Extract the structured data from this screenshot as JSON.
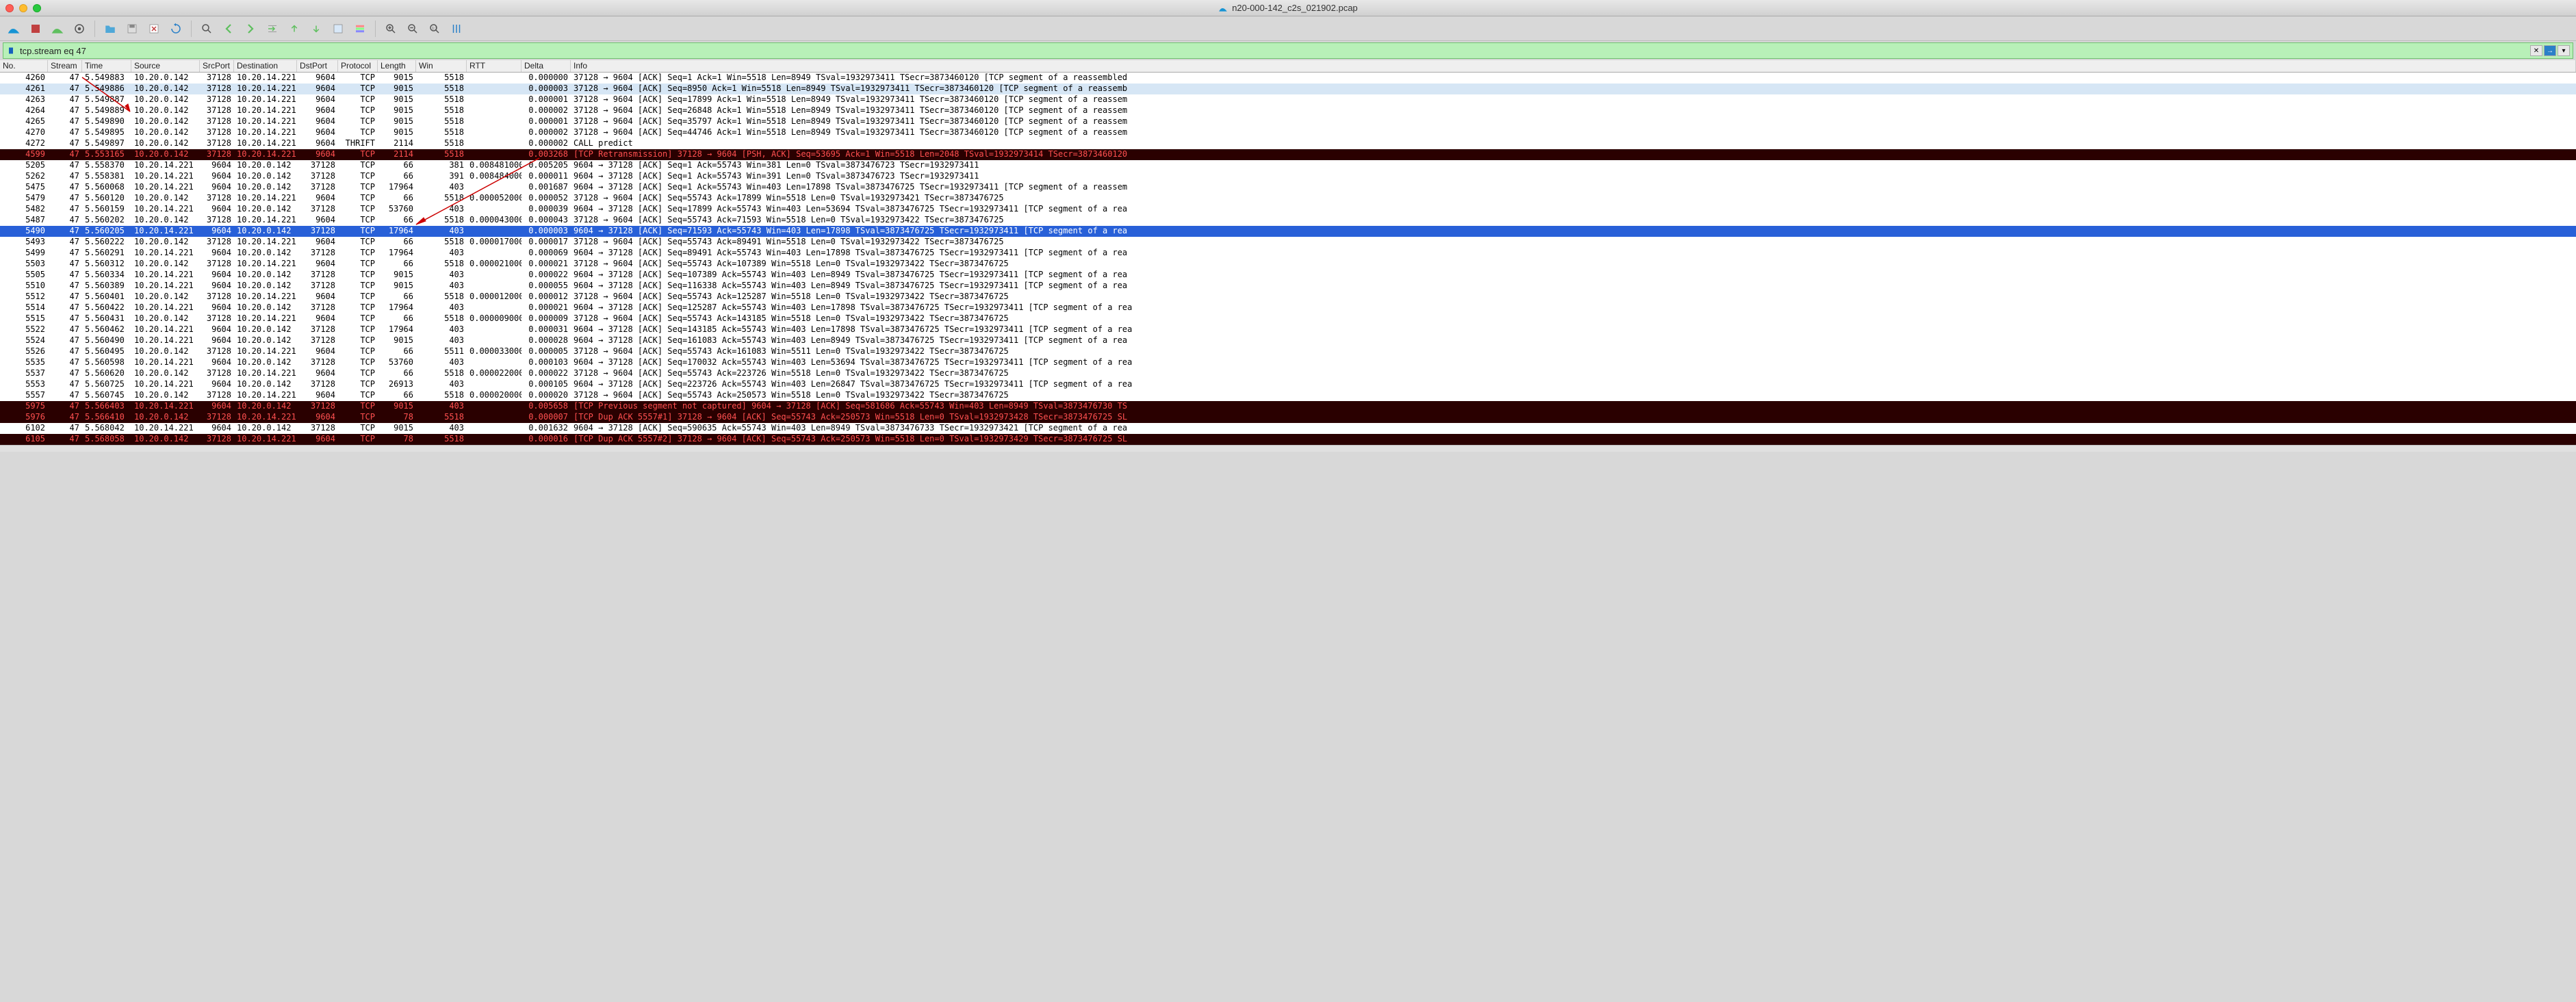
{
  "window": {
    "title": "n20-000-142_c2s_021902.pcap"
  },
  "filter": {
    "value": "tcp.stream eq 47"
  },
  "columns": [
    {
      "key": "no",
      "label": "No."
    },
    {
      "key": "stream",
      "label": "Stream"
    },
    {
      "key": "time",
      "label": "Time"
    },
    {
      "key": "src",
      "label": "Source"
    },
    {
      "key": "sport",
      "label": "SrcPort"
    },
    {
      "key": "dst",
      "label": "Destination"
    },
    {
      "key": "dport",
      "label": "DstPort"
    },
    {
      "key": "proto",
      "label": "Protocol"
    },
    {
      "key": "len",
      "label": "Length"
    },
    {
      "key": "win",
      "label": "Win"
    },
    {
      "key": "rtt",
      "label": "RTT"
    },
    {
      "key": "delta",
      "label": "Delta"
    },
    {
      "key": "info",
      "label": "Info"
    }
  ],
  "rows": [
    {
      "cls": "normal",
      "no": "4260",
      "stream": "47",
      "time": "5.549883",
      "src": "10.20.0.142",
      "sport": "37128",
      "dst": "10.20.14.221",
      "dport": "9604",
      "proto": "TCP",
      "len": "9015",
      "win": "5518",
      "rtt": "",
      "delta": "0.000000",
      "info": "37128 → 9604 [ACK] Seq=1 Ack=1 Win=5518 Len=8949 TSval=1932973411 TSecr=3873460120 [TCP segment of a reassembled"
    },
    {
      "cls": "lightblue",
      "no": "4261",
      "stream": "47",
      "time": "5.549886",
      "src": "10.20.0.142",
      "sport": "37128",
      "dst": "10.20.14.221",
      "dport": "9604",
      "proto": "TCP",
      "len": "9015",
      "win": "5518",
      "rtt": "",
      "delta": "0.000003",
      "info": "37128 → 9604 [ACK] Seq=8950 Ack=1 Win=5518 Len=8949 TSval=1932973411 TSecr=3873460120 [TCP segment of a reassemb"
    },
    {
      "cls": "normal",
      "no": "4263",
      "stream": "47",
      "time": "5.549887",
      "src": "10.20.0.142",
      "sport": "37128",
      "dst": "10.20.14.221",
      "dport": "9604",
      "proto": "TCP",
      "len": "9015",
      "win": "5518",
      "rtt": "",
      "delta": "0.000001",
      "info": "37128 → 9604 [ACK] Seq=17899 Ack=1 Win=5518 Len=8949 TSval=1932973411 TSecr=3873460120 [TCP segment of a reassem"
    },
    {
      "cls": "normal",
      "no": "4264",
      "stream": "47",
      "time": "5.549889",
      "src": "10.20.0.142",
      "sport": "37128",
      "dst": "10.20.14.221",
      "dport": "9604",
      "proto": "TCP",
      "len": "9015",
      "win": "5518",
      "rtt": "",
      "delta": "0.000002",
      "info": "37128 → 9604 [ACK] Seq=26848 Ack=1 Win=5518 Len=8949 TSval=1932973411 TSecr=3873460120 [TCP segment of a reassem"
    },
    {
      "cls": "normal",
      "no": "4265",
      "stream": "47",
      "time": "5.549890",
      "src": "10.20.0.142",
      "sport": "37128",
      "dst": "10.20.14.221",
      "dport": "9604",
      "proto": "TCP",
      "len": "9015",
      "win": "5518",
      "rtt": "",
      "delta": "0.000001",
      "info": "37128 → 9604 [ACK] Seq=35797 Ack=1 Win=5518 Len=8949 TSval=1932973411 TSecr=3873460120 [TCP segment of a reassem"
    },
    {
      "cls": "normal",
      "no": "4270",
      "stream": "47",
      "time": "5.549895",
      "src": "10.20.0.142",
      "sport": "37128",
      "dst": "10.20.14.221",
      "dport": "9604",
      "proto": "TCP",
      "len": "9015",
      "win": "5518",
      "rtt": "",
      "delta": "0.000002",
      "info": "37128 → 9604 [ACK] Seq=44746 Ack=1 Win=5518 Len=8949 TSval=1932973411 TSecr=3873460120 [TCP segment of a reassem"
    },
    {
      "cls": "normal",
      "no": "4272",
      "stream": "47",
      "time": "5.549897",
      "src": "10.20.0.142",
      "sport": "37128",
      "dst": "10.20.14.221",
      "dport": "9604",
      "proto": "THRIFT",
      "len": "2114",
      "win": "5518",
      "rtt": "",
      "delta": "0.000002",
      "info": "CALL predict"
    },
    {
      "cls": "darkred",
      "no": "4599",
      "stream": "47",
      "time": "5.553165",
      "src": "10.20.0.142",
      "sport": "37128",
      "dst": "10.20.14.221",
      "dport": "9604",
      "proto": "TCP",
      "len": "2114",
      "win": "5518",
      "rtt": "",
      "delta": "0.003268",
      "info": "[TCP Retransmission] 37128 → 9604 [PSH, ACK] Seq=53695 Ack=1 Win=5518 Len=2048 TSval=1932973414 TSecr=3873460120"
    },
    {
      "cls": "normal",
      "no": "5205",
      "stream": "47",
      "time": "5.558370",
      "src": "10.20.14.221",
      "sport": "9604",
      "dst": "10.20.0.142",
      "dport": "37128",
      "proto": "TCP",
      "len": "66",
      "win": "381",
      "rtt": "0.008481000",
      "delta": "0.005205",
      "info": "9604 → 37128 [ACK] Seq=1 Ack=55743 Win=381 Len=0 TSval=3873476723 TSecr=1932973411"
    },
    {
      "cls": "normal",
      "no": "5262",
      "stream": "47",
      "time": "5.558381",
      "src": "10.20.14.221",
      "sport": "9604",
      "dst": "10.20.0.142",
      "dport": "37128",
      "proto": "TCP",
      "len": "66",
      "win": "391",
      "rtt": "0.008484000",
      "delta": "0.000011",
      "info": "9604 → 37128 [ACK] Seq=1 Ack=55743 Win=391 Len=0 TSval=3873476723 TSecr=1932973411"
    },
    {
      "cls": "normal",
      "no": "5475",
      "stream": "47",
      "time": "5.560068",
      "src": "10.20.14.221",
      "sport": "9604",
      "dst": "10.20.0.142",
      "dport": "37128",
      "proto": "TCP",
      "len": "17964",
      "win": "403",
      "rtt": "",
      "delta": "0.001687",
      "info": "9604 → 37128 [ACK] Seq=1 Ack=55743 Win=403 Len=17898 TSval=3873476725 TSecr=1932973411 [TCP segment of a reassem"
    },
    {
      "cls": "normal",
      "no": "5479",
      "stream": "47",
      "time": "5.560120",
      "src": "10.20.0.142",
      "sport": "37128",
      "dst": "10.20.14.221",
      "dport": "9604",
      "proto": "TCP",
      "len": "66",
      "win": "5518",
      "rtt": "0.000052000",
      "delta": "0.000052",
      "info": "37128 → 9604 [ACK] Seq=55743 Ack=17899 Win=5518 Len=0 TSval=1932973421 TSecr=3873476725"
    },
    {
      "cls": "normal",
      "no": "5482",
      "stream": "47",
      "time": "5.560159",
      "src": "10.20.14.221",
      "sport": "9604",
      "dst": "10.20.0.142",
      "dport": "37128",
      "proto": "TCP",
      "len": "53760",
      "win": "403",
      "rtt": "",
      "delta": "0.000039",
      "info": "9604 → 37128 [ACK] Seq=17899 Ack=55743 Win=403 Len=53694 TSval=3873476725 TSecr=1932973411 [TCP segment of a rea"
    },
    {
      "cls": "normal",
      "no": "5487",
      "stream": "47",
      "time": "5.560202",
      "src": "10.20.0.142",
      "sport": "37128",
      "dst": "10.20.14.221",
      "dport": "9604",
      "proto": "TCP",
      "len": "66",
      "win": "5518",
      "rtt": "0.000043000",
      "delta": "0.000043",
      "info": "37128 → 9604 [ACK] Seq=55743 Ack=71593 Win=5518 Len=0 TSval=1932973422 TSecr=3873476725"
    },
    {
      "cls": "selected",
      "no": "5490",
      "stream": "47",
      "time": "5.560205",
      "src": "10.20.14.221",
      "sport": "9604",
      "dst": "10.20.0.142",
      "dport": "37128",
      "proto": "TCP",
      "len": "17964",
      "win": "403",
      "rtt": "",
      "delta": "0.000003",
      "info": "9604 → 37128 [ACK] Seq=71593 Ack=55743 Win=403 Len=17898 TSval=3873476725 TSecr=1932973411 [TCP segment of a rea"
    },
    {
      "cls": "normal",
      "no": "5493",
      "stream": "47",
      "time": "5.560222",
      "src": "10.20.0.142",
      "sport": "37128",
      "dst": "10.20.14.221",
      "dport": "9604",
      "proto": "TCP",
      "len": "66",
      "win": "5518",
      "rtt": "0.000017000",
      "delta": "0.000017",
      "info": "37128 → 9604 [ACK] Seq=55743 Ack=89491 Win=5518 Len=0 TSval=1932973422 TSecr=3873476725"
    },
    {
      "cls": "normal",
      "no": "5499",
      "stream": "47",
      "time": "5.560291",
      "src": "10.20.14.221",
      "sport": "9604",
      "dst": "10.20.0.142",
      "dport": "37128",
      "proto": "TCP",
      "len": "17964",
      "win": "403",
      "rtt": "",
      "delta": "0.000069",
      "info": "9604 → 37128 [ACK] Seq=89491 Ack=55743 Win=403 Len=17898 TSval=3873476725 TSecr=1932973411 [TCP segment of a rea"
    },
    {
      "cls": "normal",
      "no": "5503",
      "stream": "47",
      "time": "5.560312",
      "src": "10.20.0.142",
      "sport": "37128",
      "dst": "10.20.14.221",
      "dport": "9604",
      "proto": "TCP",
      "len": "66",
      "win": "5518",
      "rtt": "0.000021000",
      "delta": "0.000021",
      "info": "37128 → 9604 [ACK] Seq=55743 Ack=107389 Win=5518 Len=0 TSval=1932973422 TSecr=3873476725"
    },
    {
      "cls": "normal",
      "no": "5505",
      "stream": "47",
      "time": "5.560334",
      "src": "10.20.14.221",
      "sport": "9604",
      "dst": "10.20.0.142",
      "dport": "37128",
      "proto": "TCP",
      "len": "9015",
      "win": "403",
      "rtt": "",
      "delta": "0.000022",
      "info": "9604 → 37128 [ACK] Seq=107389 Ack=55743 Win=403 Len=8949 TSval=3873476725 TSecr=1932973411 [TCP segment of a rea"
    },
    {
      "cls": "normal",
      "no": "5510",
      "stream": "47",
      "time": "5.560389",
      "src": "10.20.14.221",
      "sport": "9604",
      "dst": "10.20.0.142",
      "dport": "37128",
      "proto": "TCP",
      "len": "9015",
      "win": "403",
      "rtt": "",
      "delta": "0.000055",
      "info": "9604 → 37128 [ACK] Seq=116338 Ack=55743 Win=403 Len=8949 TSval=3873476725 TSecr=1932973411 [TCP segment of a rea"
    },
    {
      "cls": "normal",
      "no": "5512",
      "stream": "47",
      "time": "5.560401",
      "src": "10.20.0.142",
      "sport": "37128",
      "dst": "10.20.14.221",
      "dport": "9604",
      "proto": "TCP",
      "len": "66",
      "win": "5518",
      "rtt": "0.000012000",
      "delta": "0.000012",
      "info": "37128 → 9604 [ACK] Seq=55743 Ack=125287 Win=5518 Len=0 TSval=1932973422 TSecr=3873476725"
    },
    {
      "cls": "normal",
      "no": "5514",
      "stream": "47",
      "time": "5.560422",
      "src": "10.20.14.221",
      "sport": "9604",
      "dst": "10.20.0.142",
      "dport": "37128",
      "proto": "TCP",
      "len": "17964",
      "win": "403",
      "rtt": "",
      "delta": "0.000021",
      "info": "9604 → 37128 [ACK] Seq=125287 Ack=55743 Win=403 Len=17898 TSval=3873476725 TSecr=1932973411 [TCP segment of a rea"
    },
    {
      "cls": "normal",
      "no": "5515",
      "stream": "47",
      "time": "5.560431",
      "src": "10.20.0.142",
      "sport": "37128",
      "dst": "10.20.14.221",
      "dport": "9604",
      "proto": "TCP",
      "len": "66",
      "win": "5518",
      "rtt": "0.000009000",
      "delta": "0.000009",
      "info": "37128 → 9604 [ACK] Seq=55743 Ack=143185 Win=5518 Len=0 TSval=1932973422 TSecr=3873476725"
    },
    {
      "cls": "normal",
      "no": "5522",
      "stream": "47",
      "time": "5.560462",
      "src": "10.20.14.221",
      "sport": "9604",
      "dst": "10.20.0.142",
      "dport": "37128",
      "proto": "TCP",
      "len": "17964",
      "win": "403",
      "rtt": "",
      "delta": "0.000031",
      "info": "9604 → 37128 [ACK] Seq=143185 Ack=55743 Win=403 Len=17898 TSval=3873476725 TSecr=1932973411 [TCP segment of a rea"
    },
    {
      "cls": "normal",
      "no": "5524",
      "stream": "47",
      "time": "5.560490",
      "src": "10.20.14.221",
      "sport": "9604",
      "dst": "10.20.0.142",
      "dport": "37128",
      "proto": "TCP",
      "len": "9015",
      "win": "403",
      "rtt": "",
      "delta": "0.000028",
      "info": "9604 → 37128 [ACK] Seq=161083 Ack=55743 Win=403 Len=8949 TSval=3873476725 TSecr=1932973411 [TCP segment of a rea"
    },
    {
      "cls": "normal",
      "no": "5526",
      "stream": "47",
      "time": "5.560495",
      "src": "10.20.0.142",
      "sport": "37128",
      "dst": "10.20.14.221",
      "dport": "9604",
      "proto": "TCP",
      "len": "66",
      "win": "5511",
      "rtt": "0.000033000",
      "delta": "0.000005",
      "info": "37128 → 9604 [ACK] Seq=55743 Ack=161083 Win=5511 Len=0 TSval=1932973422 TSecr=3873476725"
    },
    {
      "cls": "normal",
      "no": "5535",
      "stream": "47",
      "time": "5.560598",
      "src": "10.20.14.221",
      "sport": "9604",
      "dst": "10.20.0.142",
      "dport": "37128",
      "proto": "TCP",
      "len": "53760",
      "win": "403",
      "rtt": "",
      "delta": "0.000103",
      "info": "9604 → 37128 [ACK] Seq=170032 Ack=55743 Win=403 Len=53694 TSval=3873476725 TSecr=1932973411 [TCP segment of a rea"
    },
    {
      "cls": "normal",
      "no": "5537",
      "stream": "47",
      "time": "5.560620",
      "src": "10.20.0.142",
      "sport": "37128",
      "dst": "10.20.14.221",
      "dport": "9604",
      "proto": "TCP",
      "len": "66",
      "win": "5518",
      "rtt": "0.000022000",
      "delta": "0.000022",
      "info": "37128 → 9604 [ACK] Seq=55743 Ack=223726 Win=5518 Len=0 TSval=1932973422 TSecr=3873476725"
    },
    {
      "cls": "normal",
      "no": "5553",
      "stream": "47",
      "time": "5.560725",
      "src": "10.20.14.221",
      "sport": "9604",
      "dst": "10.20.0.142",
      "dport": "37128",
      "proto": "TCP",
      "len": "26913",
      "win": "403",
      "rtt": "",
      "delta": "0.000105",
      "info": "9604 → 37128 [ACK] Seq=223726 Ack=55743 Win=403 Len=26847 TSval=3873476725 TSecr=1932973411 [TCP segment of a rea"
    },
    {
      "cls": "normal",
      "no": "5557",
      "stream": "47",
      "time": "5.560745",
      "src": "10.20.0.142",
      "sport": "37128",
      "dst": "10.20.14.221",
      "dport": "9604",
      "proto": "TCP",
      "len": "66",
      "win": "5518",
      "rtt": "0.000020000",
      "delta": "0.000020",
      "info": "37128 → 9604 [ACK] Seq=55743 Ack=250573 Win=5518 Len=0 TSval=1932973422 TSecr=3873476725"
    },
    {
      "cls": "darkred",
      "no": "5975",
      "stream": "47",
      "time": "5.566403",
      "src": "10.20.14.221",
      "sport": "9604",
      "dst": "10.20.0.142",
      "dport": "37128",
      "proto": "TCP",
      "len": "9015",
      "win": "403",
      "rtt": "",
      "delta": "0.005658",
      "info": "[TCP Previous segment not captured] 9604 → 37128 [ACK] Seq=581686 Ack=55743 Win=403 Len=8949 TSval=3873476730 TS"
    },
    {
      "cls": "darkred",
      "no": "5976",
      "stream": "47",
      "time": "5.566410",
      "src": "10.20.0.142",
      "sport": "37128",
      "dst": "10.20.14.221",
      "dport": "9604",
      "proto": "TCP",
      "len": "78",
      "win": "5518",
      "rtt": "",
      "delta": "0.000007",
      "info": "[TCP Dup ACK 5557#1] 37128 → 9604 [ACK] Seq=55743 Ack=250573 Win=5518 Len=0 TSval=1932973428 TSecr=3873476725 SL"
    },
    {
      "cls": "normal",
      "no": "6102",
      "stream": "47",
      "time": "5.568042",
      "src": "10.20.14.221",
      "sport": "9604",
      "dst": "10.20.0.142",
      "dport": "37128",
      "proto": "TCP",
      "len": "9015",
      "win": "403",
      "rtt": "",
      "delta": "0.001632",
      "info": "9604 → 37128 [ACK] Seq=590635 Ack=55743 Win=403 Len=8949 TSval=3873476733 TSecr=1932973421 [TCP segment of a rea"
    },
    {
      "cls": "darkred",
      "no": "6105",
      "stream": "47",
      "time": "5.568058",
      "src": "10.20.0.142",
      "sport": "37128",
      "dst": "10.20.14.221",
      "dport": "9604",
      "proto": "TCP",
      "len": "78",
      "win": "5518",
      "rtt": "",
      "delta": "0.000016",
      "info": "[TCP Dup ACK 5557#2] 37128 → 9604 [ACK] Seq=55743 Ack=250573 Win=5518 Len=0 TSval=1932973429 TSecr=3873476725 SL"
    }
  ]
}
